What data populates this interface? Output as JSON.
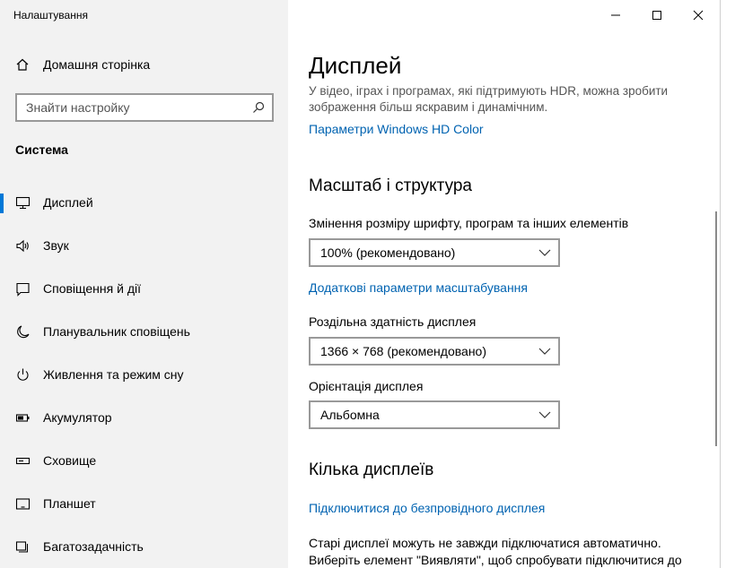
{
  "window": {
    "title": "Налаштування"
  },
  "sidebar": {
    "home_label": "Домашня сторінка",
    "search_placeholder": "Знайти настройку",
    "section_title": "Система",
    "items": [
      {
        "label": "Дисплей",
        "icon": "monitor-icon",
        "active": true
      },
      {
        "label": "Звук",
        "icon": "speaker-icon",
        "active": false
      },
      {
        "label": "Сповіщення й дії",
        "icon": "notification-icon",
        "active": false
      },
      {
        "label": "Планувальник сповіщень",
        "icon": "moon-icon",
        "active": false
      },
      {
        "label": "Живлення та режим сну",
        "icon": "power-icon",
        "active": false
      },
      {
        "label": "Акумулятор",
        "icon": "battery-icon",
        "active": false
      },
      {
        "label": "Сховище",
        "icon": "storage-icon",
        "active": false
      },
      {
        "label": "Планшет",
        "icon": "tablet-icon",
        "active": false
      },
      {
        "label": "Багатозадачність",
        "icon": "multitasking-icon",
        "active": false
      }
    ]
  },
  "main": {
    "title": "Дисплей",
    "hdr_description": "У відео, іграх і програмах, які підтримують HDR, можна зробити зображення більш яскравим і динамічним.",
    "hdr_link": "Параметри Windows HD Color",
    "scale_section": {
      "title": "Масштаб і структура",
      "size_label": "Змінення розміру шрифту, програм та інших елементів",
      "size_value": "100% (рекомендовано)",
      "advanced_link": "Додаткові параметри масштабування",
      "resolution_label": "Роздільна здатність дисплея",
      "resolution_value": "1366 × 768 (рекомендовано)",
      "orientation_label": "Орієнтація дисплея",
      "orientation_value": "Альбомна"
    },
    "multi_section": {
      "title": "Кілька дисплеїв",
      "wireless_link": "Підключитися до безпровідного дисплея",
      "description": "Старі дисплеї можуть не завжди підключатися автоматично. Виберіть елемент \"Виявляти\", щоб спробувати підключитися до"
    }
  },
  "colors": {
    "accent": "#0078d7",
    "link": "#0063b1",
    "sidebar_bg": "#f2f2f2"
  }
}
